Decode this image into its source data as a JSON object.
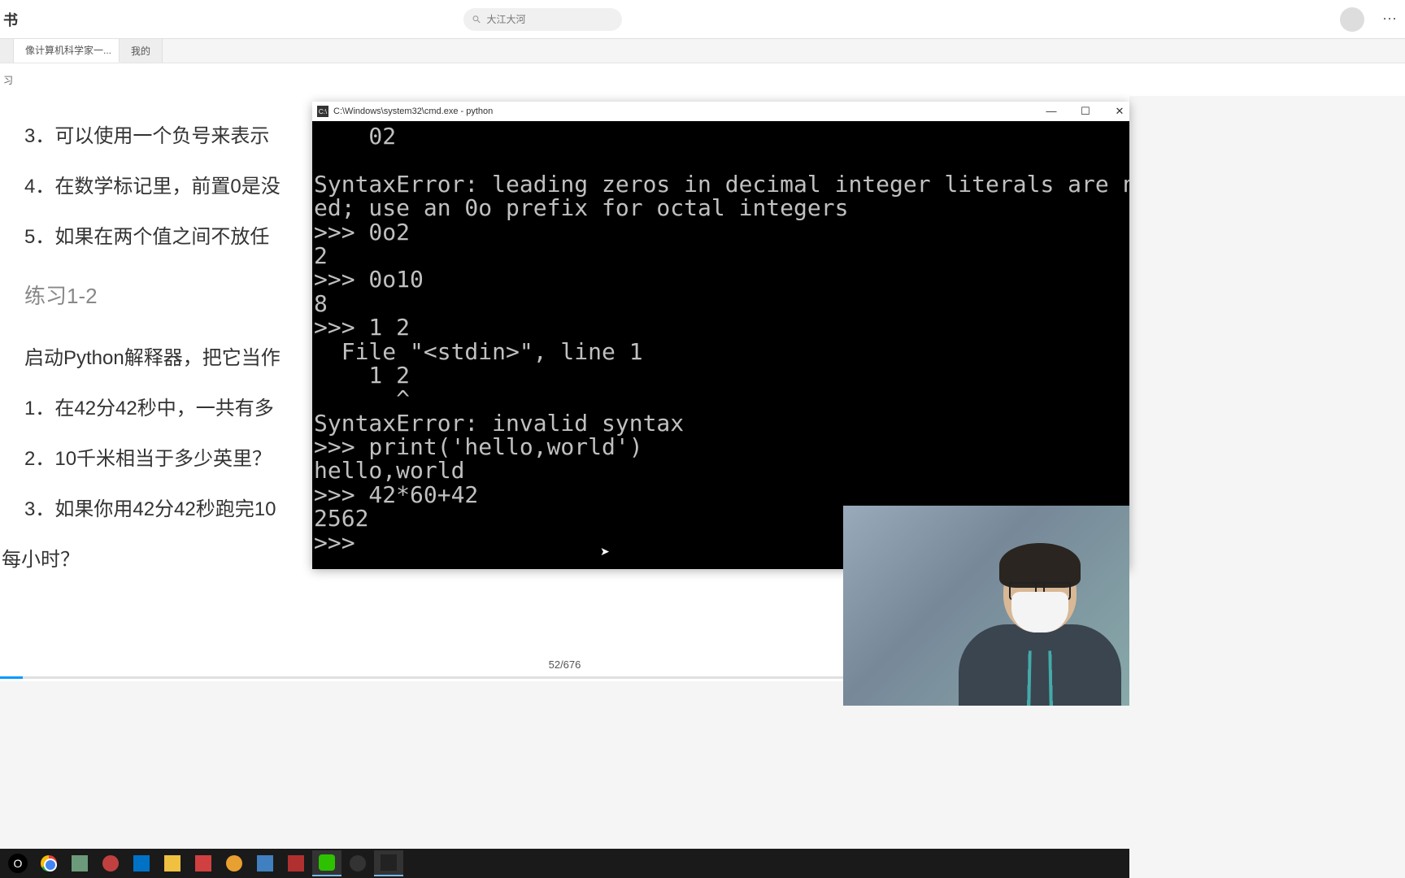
{
  "header": {
    "app_name": "书",
    "search_placeholder": "大江大河"
  },
  "tabs": {
    "first": "",
    "active": "像计算机科学家一...",
    "third": "我的"
  },
  "breadcrumb": "习",
  "document": {
    "line3": "3．可以使用一个负号来表示",
    "line4": "4．在数学标记里，前置0是没",
    "line5": "5．如果在两个值之间不放任",
    "section": "练习1-2",
    "intro": "启动Python解释器，把它当作",
    "ex1": "1．在42分42秒中，一共有多",
    "ex2": "2．10千米相当于多少英里？",
    "ex3": "3．如果你用42分42秒跑完10",
    "tail": "每小时？"
  },
  "page_counter": "52/676",
  "cmd": {
    "title": "C:\\Windows\\system32\\cmd.exe - python",
    "output": "    02\n\nSyntaxError: leading zeros in decimal integer literals are not permitt\ned; use an 0o prefix for octal integers\n>>> 0o2\n2\n>>> 0o10\n8\n>>> 1 2\n  File \"<stdin>\", line 1\n    1 2\n      ^\nSyntaxError: invalid syntax\n>>> print('hello,world')\nhello,world\n>>> 42*60+42\n2562\n>>> "
  },
  "taskbar_icons": [
    "start",
    "chrome",
    "notes",
    "search",
    "outlook",
    "files",
    "pdf",
    "sun",
    "video",
    "adobe",
    "wechat",
    "obs",
    "terminal"
  ]
}
